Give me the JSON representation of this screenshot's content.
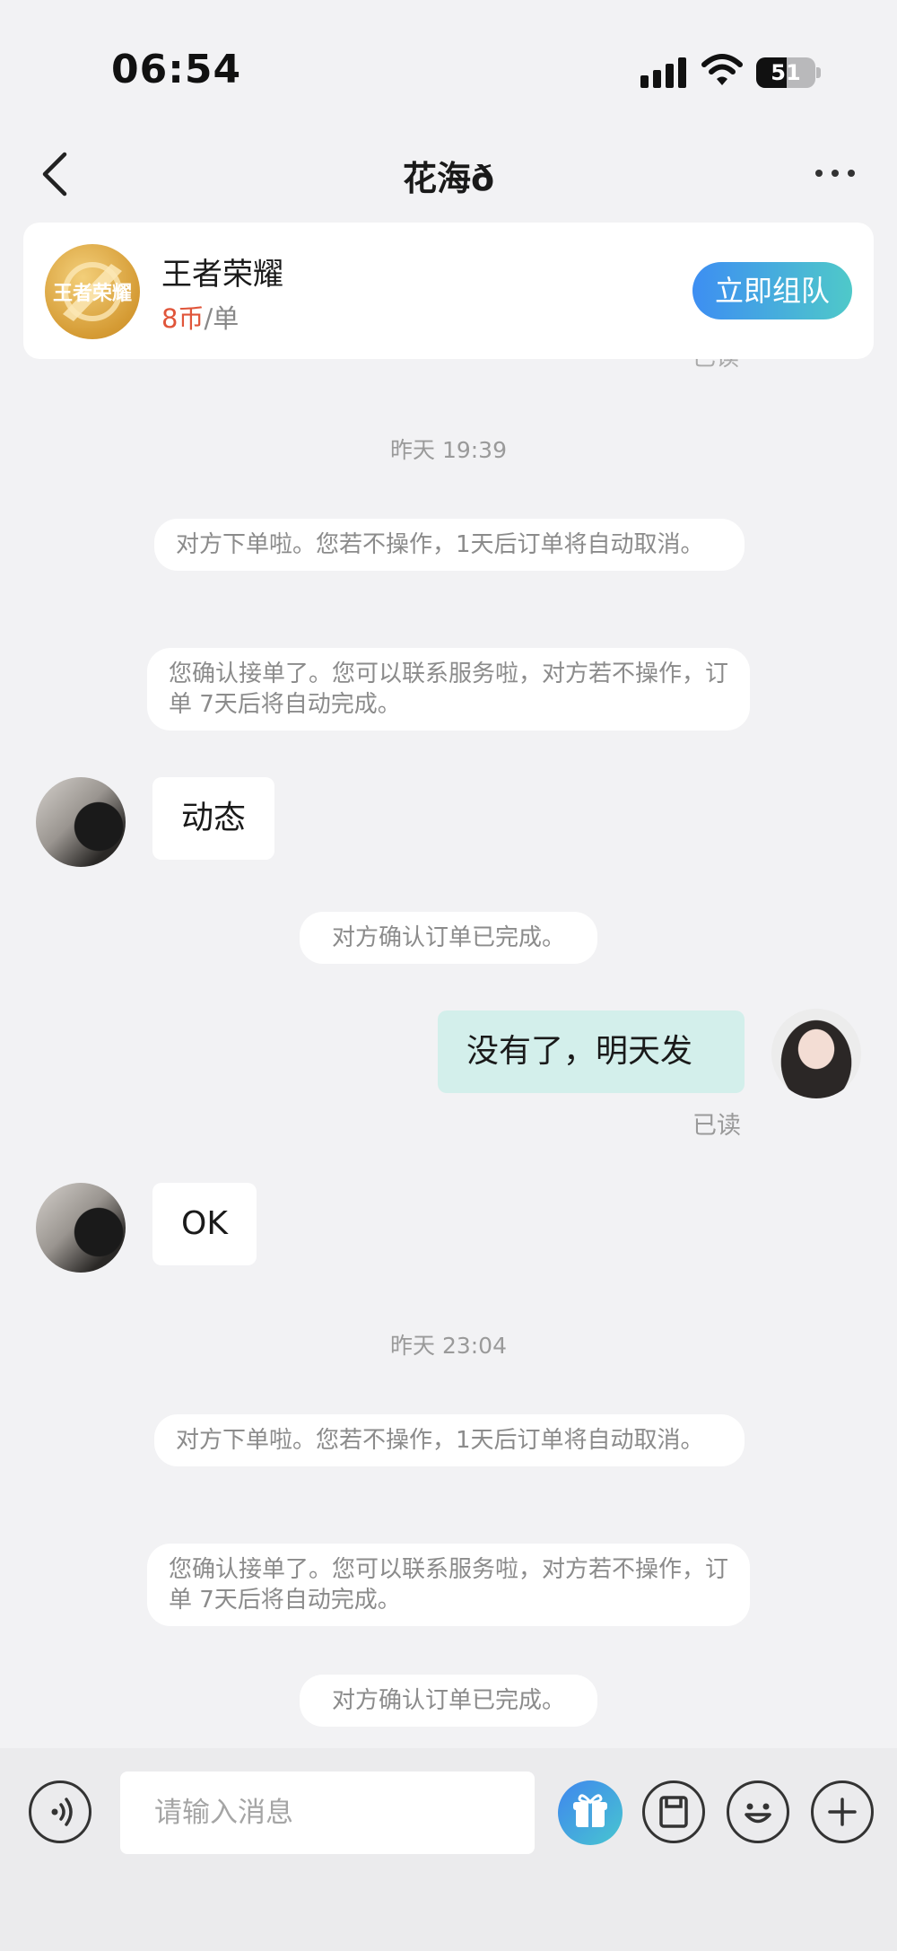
{
  "status_bar": {
    "time": "06:54",
    "battery": "51",
    "battery_level": 0.51
  },
  "header": {
    "title": "花海ð"
  },
  "service_card": {
    "game_name": "王者荣耀",
    "logo_text": "王者荣耀",
    "price_amount": "8币",
    "price_unit": "/单",
    "cta_label": "立即组队",
    "peek_text": "已读"
  },
  "messages": {
    "ts1": "昨天 19:39",
    "sys1": "对方下单啦。您若不操作，1天后订单将自动取消。",
    "sys2": "您确认接单了。您可以联系服务啦，对方若不操作，订单 7天后将自动完成。",
    "recv1": "动态",
    "sys3": "对方确认订单已完成。",
    "sent1": "没有了，明天发",
    "read1": "已读",
    "recv2": "OK",
    "ts2": "昨天 23:04",
    "sys4": "对方下单啦。您若不操作，1天后订单将自动取消。",
    "sys5": "您确认接单了。您可以联系服务啦，对方若不操作，订单 7天后将自动完成。",
    "sys6": "对方确认订单已完成。"
  },
  "input_bar": {
    "placeholder": "请输入消息"
  },
  "icons": {
    "voice": "voice-icon",
    "gift": "gift-icon",
    "order": "order-icon",
    "emoji": "emoji-icon",
    "plus": "plus-icon"
  },
  "colors": {
    "accent_gradient_start": "#3d8ef2",
    "accent_gradient_end": "#4fc9c9",
    "price": "#e0553a",
    "sent_bubble": "#d3efeb"
  }
}
